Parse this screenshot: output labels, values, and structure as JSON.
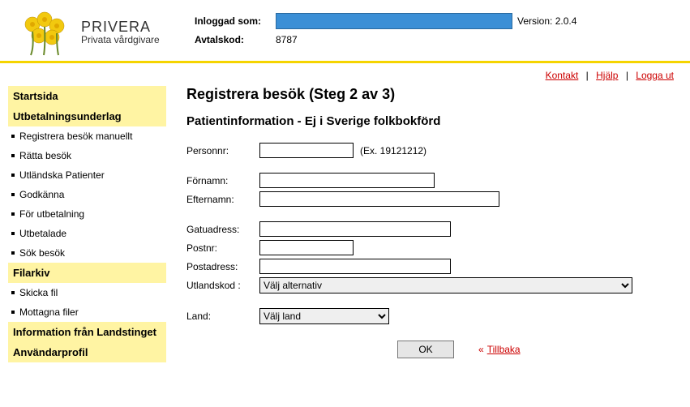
{
  "header": {
    "brand_name": "PRIVERA",
    "brand_sub": "Privata vårdgivare",
    "logged_in_label": "Inloggad som:",
    "version_label": "Version:",
    "version_value": "2.0.4",
    "avtalskod_label": "Avtalskod:",
    "avtalskod_value": "8787"
  },
  "top_links": {
    "kontakt": "Kontakt",
    "hjalp": "Hjälp",
    "logga_ut": "Logga ut"
  },
  "sidebar": {
    "sections": [
      {
        "header": "Startsida",
        "items": []
      },
      {
        "header": "Utbetalningsunderlag",
        "items": [
          "Registrera besök manuellt",
          "Rätta besök",
          "Utländska Patienter",
          "Godkänna",
          "För utbetalning",
          "Utbetalade",
          "Sök besök"
        ]
      },
      {
        "header": "Filarkiv",
        "items": [
          "Skicka fil",
          "Mottagna filer"
        ]
      },
      {
        "header": "Information från Landstinget",
        "items": []
      },
      {
        "header": "Användarprofil",
        "items": []
      }
    ]
  },
  "content": {
    "page_title": "Registrera besök (Steg 2 av 3)",
    "sub_title": "Patientinformation - Ej i Sverige folkbokförd",
    "fields": {
      "personnr_label": "Personnr:",
      "personnr_hint": "(Ex. 19121212)",
      "fornamn_label": "Förnamn:",
      "efternamn_label": "Efternamn:",
      "gatuadress_label": "Gatuadress:",
      "postnr_label": "Postnr:",
      "postadress_label": "Postadress:",
      "utlandskod_label": "Utlandskod :",
      "utlandskod_selected": "Välj alternativ",
      "land_label": "Land:",
      "land_selected": "Välj land"
    },
    "actions": {
      "ok": "OK",
      "tillbaka": "Tillbaka"
    }
  }
}
